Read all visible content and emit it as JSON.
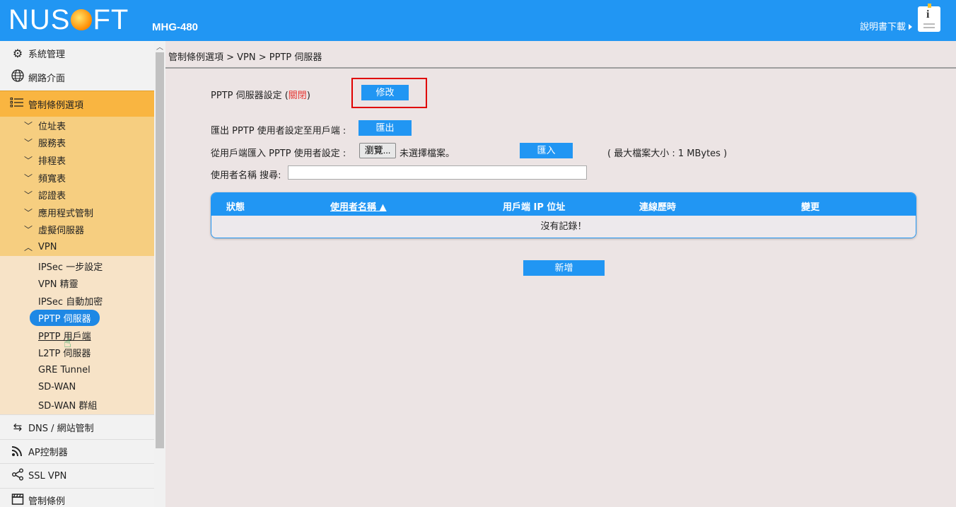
{
  "header": {
    "logo": "NUSOFT",
    "model": "MHG-480",
    "manual_link": "說明書下載"
  },
  "sidebar": {
    "top_items": [
      {
        "label": "系統管理",
        "icon": "gear-icon"
      },
      {
        "label": "網路介面",
        "icon": "globe-icon"
      }
    ],
    "section": {
      "label": "管制條例選項",
      "icon": "list-icon"
    },
    "sub_items": [
      "位址表",
      "服務表",
      "排程表",
      "頻寬表",
      "認證表",
      "應用程式管制",
      "虛擬伺服器"
    ],
    "vpn_group": "VPN",
    "vpn_items": [
      "IPSec 一步設定",
      "VPN 精靈",
      "IPSec 自動加密",
      "PPTP 伺服器",
      "PPTP 用戶端",
      "L2TP 伺服器",
      "GRE Tunnel",
      "SD-WAN",
      "SD-WAN 群組"
    ],
    "bottom_items": [
      {
        "label": "DNS / 網站管制",
        "icon": "sync-icon"
      },
      {
        "label": "AP控制器",
        "icon": "wifi-icon"
      },
      {
        "label": "SSL VPN",
        "icon": "share-icon"
      },
      {
        "label": "管制條例",
        "icon": "clapper-icon"
      }
    ]
  },
  "main": {
    "breadcrumb": "管制條例選項 > VPN > PPTP 伺服器",
    "server_setting_label": "PPTP 伺服器設定 (",
    "server_status": "關閉",
    "server_setting_close": ")",
    "modify_button": "修改",
    "export_label": "匯出 PPTP 使用者設定至用戶端 :",
    "export_button": "匯出",
    "import_label": "從用戶端匯入 PPTP 使用者設定 :",
    "browse_button": "瀏覽...",
    "no_file": "未選擇檔案。",
    "import_button": "匯入",
    "max_size": "( 最大檔案大小 : 1 MBytes )",
    "search_label": "使用者名稱 搜尋:",
    "search_value": "",
    "table": {
      "headers": [
        "狀態",
        "使用者名稱",
        "用戶端 IP 位址",
        "連線歷時",
        "變更"
      ],
      "empty": "沒有記錄！"
    },
    "add_button": "新增"
  }
}
